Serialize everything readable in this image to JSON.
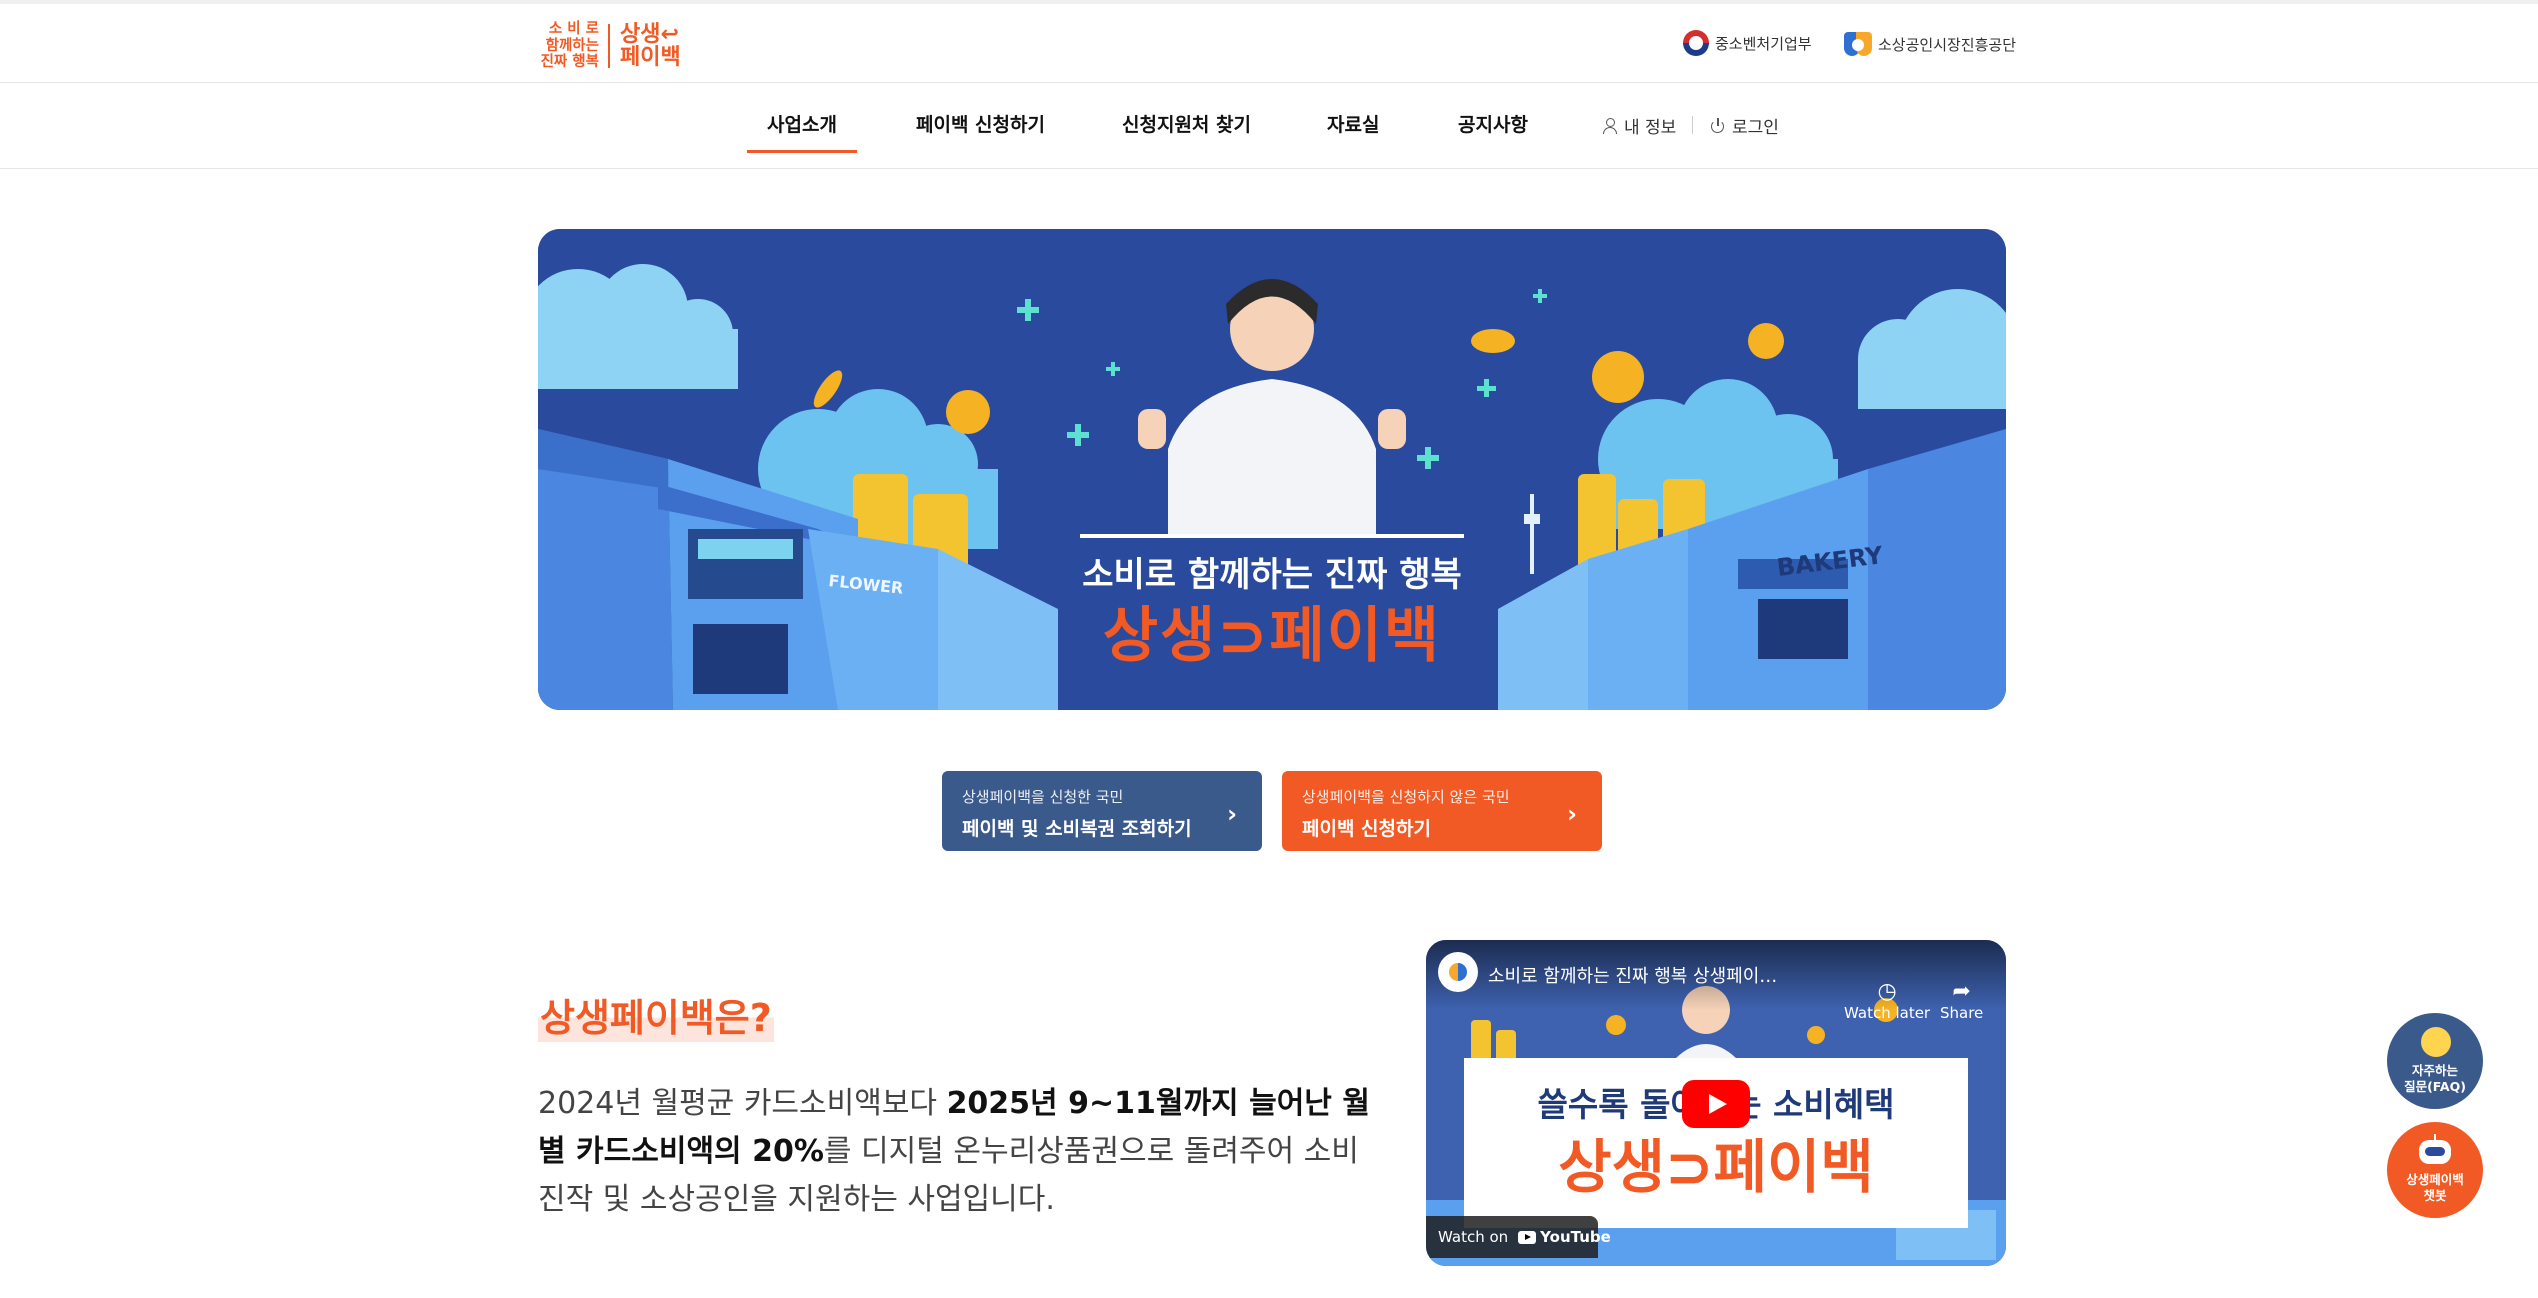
{
  "header": {
    "logo": {
      "slogan_lines": [
        "소 비 로",
        "함께하는",
        "진짜 행복"
      ],
      "brand_lines": [
        "상생↩",
        "페이백"
      ]
    },
    "gov_links": [
      {
        "label": "중소벤처기업부",
        "icon": "taegeuk-emblem-icon"
      },
      {
        "label": "소상공인시장진흥공단",
        "icon": "semas-shield-icon"
      }
    ]
  },
  "nav": {
    "items": [
      "사업소개",
      "페이백 신청하기",
      "신청지원처 찾기",
      "자료실",
      "공지사항"
    ],
    "active_index": 0,
    "utility": {
      "my_info": "내 정보",
      "login": "로그인"
    }
  },
  "banner": {
    "subtitle": "소비로 함께하는 진짜 행복",
    "title": "상생⊃페이백",
    "shop_signs": [
      "FLOWER",
      "BAKERY"
    ]
  },
  "cta": {
    "applied": {
      "caption": "상생페이백을 신청한 국민",
      "label": "페이백 및 소비복권 조회하기"
    },
    "not_applied": {
      "caption": "상생페이백을 신청하지 않은 국민",
      "label": "페이백 신청하기"
    }
  },
  "intro": {
    "title": "상생페이백은?",
    "text_parts": {
      "p1": "2024년 월평균 카드소비액보다 ",
      "p2": "2025년 9~11월까지 늘어난 월별 카드소비액의 20%",
      "p3": "를 디지털 온누리상품권으로 돌려주어 소비진작 및 소상공인을 지원하는 사업입니다."
    }
  },
  "video": {
    "title": "소비로 함께하는 진짜 행복 상생페이백 신청 가...",
    "watch_later": "Watch later",
    "share": "Share",
    "thumb_line1": "쓸수록 돌아오는 소비혜택",
    "thumb_line2": "상생⊃페이백",
    "watch_on": "Watch on",
    "youtube": "YouTube"
  },
  "floating": {
    "faq": [
      "자주하는",
      "질문(FAQ)"
    ],
    "chatbot": [
      "상생페이백",
      "챗봇"
    ]
  },
  "colors": {
    "accent": "#f15a24",
    "navy": "#3b5a8c",
    "banner_bg": "#2a4a9e"
  }
}
